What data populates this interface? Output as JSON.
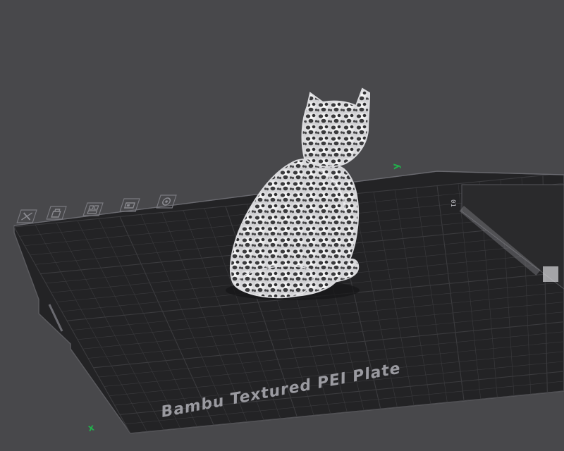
{
  "viewport": {
    "background": "#48484b"
  },
  "plate": {
    "label": "Bambu Textured PEI Plate",
    "plate_number": "01",
    "surface_color": "#232325",
    "grid_color": "#3b3b3e",
    "label_color": "#9a9aa0"
  },
  "axes": {
    "x_label": "x",
    "y_label": "y",
    "color": "#22b14c"
  },
  "plate_toolbar": {
    "icons": [
      {
        "name": "delete-plate-icon"
      },
      {
        "name": "lock-plate-icon"
      },
      {
        "name": "arrange-icon"
      },
      {
        "name": "orient-icon"
      },
      {
        "name": "plate-settings-icon"
      }
    ]
  },
  "model": {
    "name": "voronoi-cat",
    "color": "#e8e8ea"
  }
}
